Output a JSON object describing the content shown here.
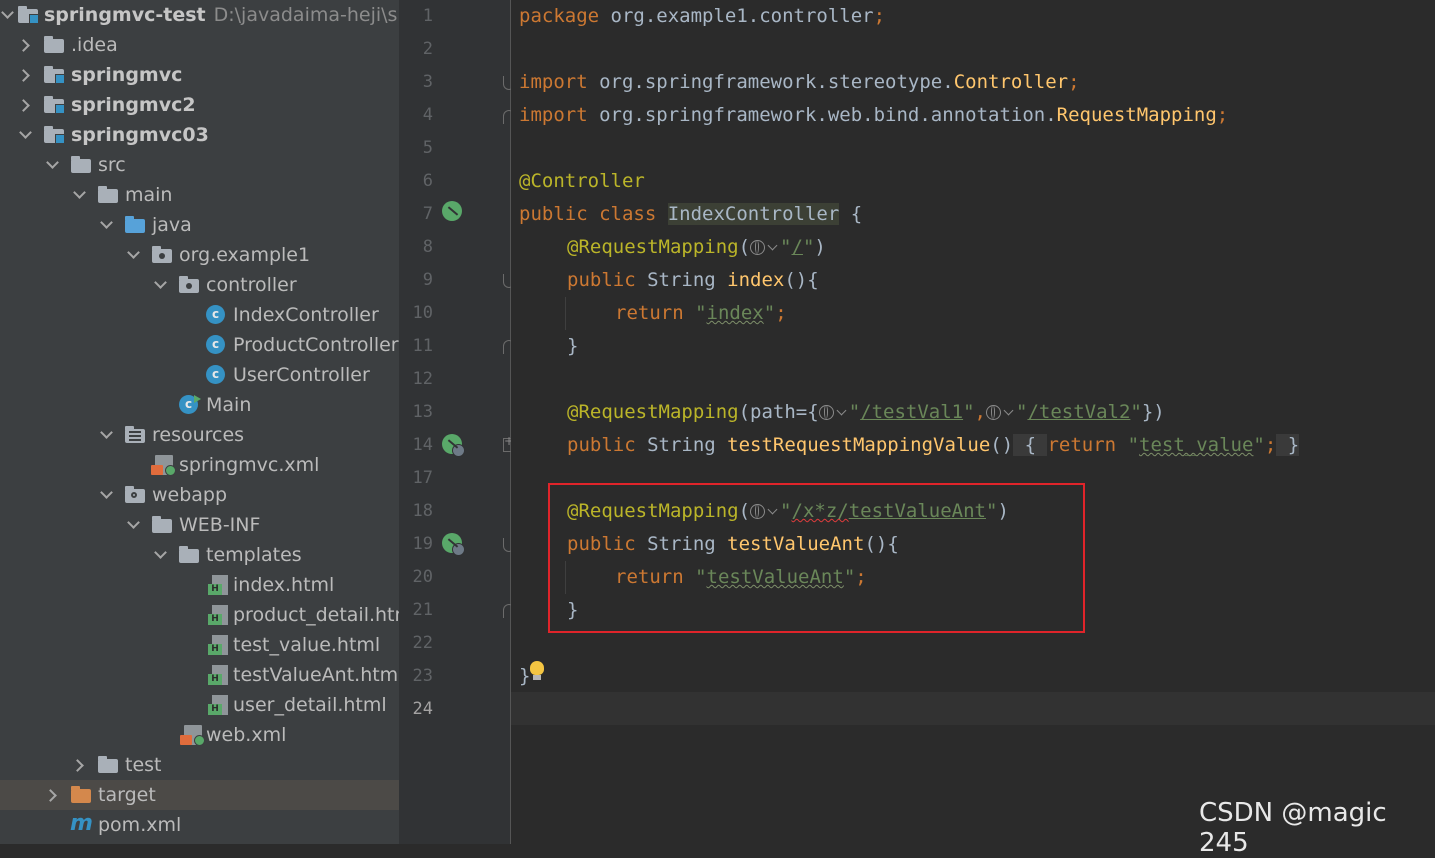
{
  "project": {
    "root_name": "springmvc-test",
    "root_path": "D:\\javadaima-heji\\spring",
    "items": [
      {
        "label": "springmvc-test"
      },
      {
        "label": ".idea"
      },
      {
        "label": "springmvc"
      },
      {
        "label": "springmvc2"
      },
      {
        "label": "springmvc03"
      },
      {
        "label": "src"
      },
      {
        "label": "main"
      },
      {
        "label": "java"
      },
      {
        "label": "org.example1"
      },
      {
        "label": "controller"
      },
      {
        "label": "IndexController"
      },
      {
        "label": "ProductController"
      },
      {
        "label": "UserController"
      },
      {
        "label": "Main"
      },
      {
        "label": "resources"
      },
      {
        "label": "springmvc.xml"
      },
      {
        "label": "webapp"
      },
      {
        "label": "WEB-INF"
      },
      {
        "label": "templates"
      },
      {
        "label": "index.html"
      },
      {
        "label": "product_detail.htm"
      },
      {
        "label": "test_value.html"
      },
      {
        "label": "testValueAnt.html"
      },
      {
        "label": "user_detail.html"
      },
      {
        "label": "web.xml"
      },
      {
        "label": "test"
      },
      {
        "label": "target"
      },
      {
        "label": "pom.xml"
      }
    ]
  },
  "editor": {
    "line_numbers": [
      "1",
      "2",
      "3",
      "4",
      "5",
      "6",
      "7",
      "8",
      "9",
      "10",
      "11",
      "12",
      "13",
      "14",
      "17",
      "18",
      "19",
      "20",
      "21",
      "22",
      "23",
      "24"
    ],
    "code": {
      "l1_kw": "package",
      "l1_rest": " org.example1.controller",
      "semi": ";",
      "import_kw": "import",
      "l3_pkg": " org.springframework.stereotype.",
      "l3_cls": "Controller",
      "l4_pkg": " org.springframework.web.bind.annotation.",
      "l4_cls": "RequestMapping",
      "l6_ann": "@Controller",
      "l7_kw": "public class ",
      "l7_cls": "IndexController",
      "l7_rest": " {",
      "ann_rm": "@RequestMapping",
      "paren_open": "(",
      "paren_close": ")",
      "quote": "\"",
      "l8_path": "/",
      "public_kw": "public ",
      "string_type": "String ",
      "l9_fn": "index",
      "l9_rest": "(){",
      "return_kw": "return ",
      "l10_str": "index",
      "close_brace": "}",
      "l13_path_key": "path={",
      "l13_val1": "/testVal1",
      "comma": ",",
      "l13_val2": "/testVal2",
      "l13_end": "})",
      "l14_fn": "testRequestMappingValue",
      "l14_paren": "()",
      "l14_open": " { ",
      "l14_str": "test_value",
      "l14_close": " }",
      "l18_path_a": "/x*z/",
      "l18_path_b": "testValueAnt",
      "l19_fn": "testValueAnt",
      "l19_rest": "(){",
      "l20_str": "testValueAnt"
    }
  },
  "watermark": "CSDN @magic 245"
}
